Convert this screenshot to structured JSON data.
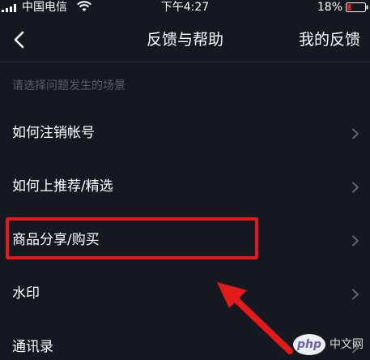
{
  "status_bar": {
    "carrier": "中国电信",
    "time": "下午4:27",
    "battery": "18%",
    "icons": [
      "signal-icon",
      "wifi-icon",
      "battery-icon"
    ]
  },
  "nav": {
    "back_icon": "chevron-left-icon",
    "title": "反馈与帮助",
    "right_action": "我的反馈"
  },
  "section_header": "请选择问题发生的场景",
  "list": {
    "items": [
      {
        "label": "如何注销帐号"
      },
      {
        "label": "如何上推荐/精选"
      },
      {
        "label": "商品分享/购买",
        "highlighted": true
      },
      {
        "label": "水印"
      },
      {
        "label": "通讯录"
      }
    ],
    "item_icon": "chevron-right-icon"
  },
  "annotation": {
    "highlight_color": "#e31a1a",
    "arrow_color": "#e31a1a"
  },
  "watermark": {
    "logo": "php",
    "text": "中文网"
  },
  "colors": {
    "background": "#161821",
    "text": "#ffffff",
    "secondary_text": "#5a5c66",
    "chevron": "#6b6d78",
    "divider": "#262833"
  }
}
